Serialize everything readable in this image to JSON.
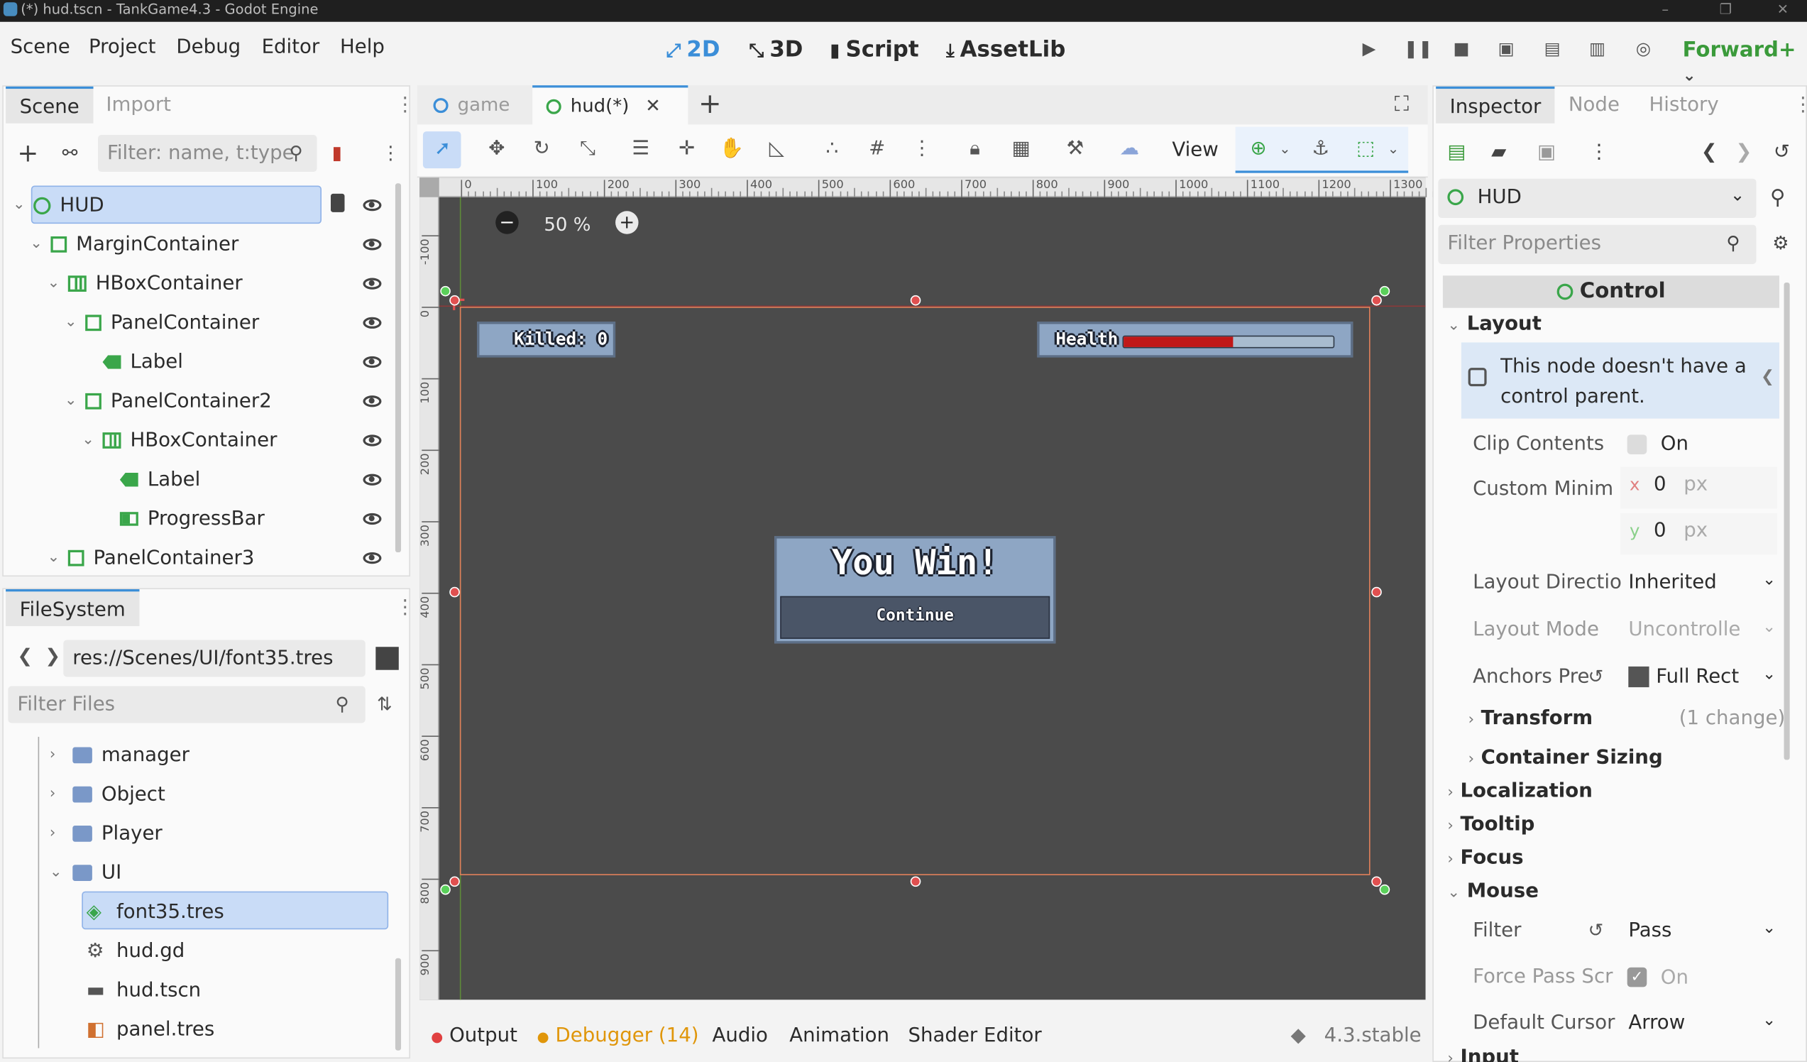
{
  "window": {
    "title": "(*) hud.tscn - TankGame4.3 - Godot Engine"
  },
  "menu": [
    "Scene",
    "Project",
    "Debug",
    "Editor",
    "Help"
  ],
  "workspaces": [
    {
      "label": "2D",
      "icon": "2d-icon",
      "active": true
    },
    {
      "label": "3D",
      "icon": "3d-icon",
      "active": false
    },
    {
      "label": "Script",
      "icon": "script-icon",
      "active": false
    },
    {
      "label": "AssetLib",
      "icon": "assetlib-icon",
      "active": false
    }
  ],
  "renderer": "Forward+",
  "scene_dock": {
    "tabs": [
      "Scene",
      "Import"
    ],
    "filter_placeholder": "Filter: name, t:type",
    "tree": [
      {
        "label": "HUD",
        "type": "control-root",
        "selected": true
      },
      {
        "label": "MarginContainer",
        "type": "control"
      },
      {
        "label": "HBoxContainer",
        "type": "hbox"
      },
      {
        "label": "PanelContainer",
        "type": "control"
      },
      {
        "label": "Label",
        "type": "label"
      },
      {
        "label": "PanelContainer2",
        "type": "control"
      },
      {
        "label": "HBoxContainer",
        "type": "hbox"
      },
      {
        "label": "Label",
        "type": "label"
      },
      {
        "label": "ProgressBar",
        "type": "progress"
      },
      {
        "label": "PanelContainer3",
        "type": "control"
      }
    ]
  },
  "filesystem": {
    "title": "FileSystem",
    "path": "res://Scenes/UI/font35.tres",
    "filter_placeholder": "Filter Files",
    "items": [
      "manager",
      "Object",
      "Player",
      "UI",
      "font35.tres",
      "hud.gd",
      "hud.tscn",
      "panel.tres"
    ]
  },
  "editor_tabs": [
    "game",
    "hud(*)"
  ],
  "toolbar": {
    "view_label": "View"
  },
  "zoom": "50 %",
  "ruler_h": [
    "0",
    "100",
    "200",
    "300",
    "400",
    "500",
    "600",
    "700",
    "800",
    "900",
    "1000",
    "1100",
    "1200",
    "1300"
  ],
  "ruler_v": [
    "-100",
    "0",
    "100",
    "200",
    "300",
    "400",
    "500",
    "600",
    "700",
    "800",
    "900"
  ],
  "game_ui": {
    "killed": "Killed: 0",
    "health": "Health",
    "health_fraction": 0.52,
    "win_title": "You Win!",
    "continue": "Continue"
  },
  "colors": {
    "accent": "#3b8ed8",
    "node_green": "#3aa64a",
    "health_red": "#c01818",
    "selection_orange": "#e0805a"
  },
  "bottom": {
    "tabs": [
      "Output",
      "Debugger (14)",
      "Audio",
      "Animation",
      "Shader Editor"
    ],
    "version": "4.3.stable"
  },
  "inspector": {
    "tabs": [
      "Inspector",
      "Node",
      "History"
    ],
    "node": "HUD",
    "filter_placeholder": "Filter Properties",
    "class_header": "Control",
    "layout_section": "Layout",
    "warning": "This node doesn't have a control parent.",
    "clip_contents": {
      "label": "Clip Contents",
      "value": "On"
    },
    "custom_min": {
      "label": "Custom Minim",
      "x": "0",
      "y": "0",
      "unit": "px",
      "xl": "x",
      "yl": "y"
    },
    "layout_direction": {
      "label": "Layout Directio",
      "value": "Inherited"
    },
    "layout_mode": {
      "label": "Layout Mode",
      "value": "Uncontrolle"
    },
    "anchors": {
      "label": "Anchors Pre",
      "value": "Full Rect"
    },
    "transform": {
      "label": "Transform",
      "note": "(1 change)"
    },
    "container_sizing": "Container Sizing",
    "sections": [
      "Localization",
      "Tooltip",
      "Focus",
      "Mouse"
    ],
    "filter": {
      "label": "Filter",
      "value": "Pass"
    },
    "force_pass": {
      "label": "Force Pass Scr",
      "value": "On"
    },
    "default_cursor": {
      "label": "Default Cursor",
      "value": "Arrow"
    },
    "input": "Input"
  }
}
